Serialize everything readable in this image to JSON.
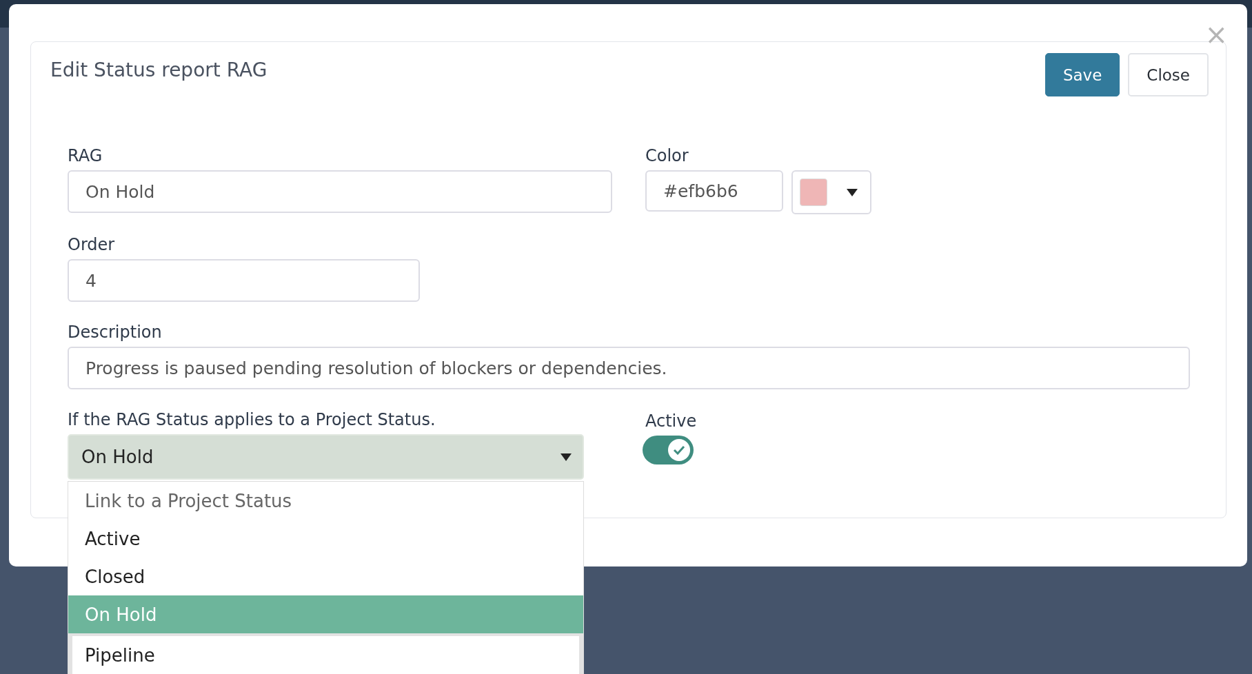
{
  "modal": {
    "title": "Edit Status report RAG",
    "buttons": [
      {
        "label": "Save",
        "kind": "primary"
      },
      {
        "label": "Close",
        "kind": "secondary"
      }
    ],
    "close_icon": "×"
  },
  "form": {
    "rag": {
      "label": "RAG",
      "value": "On Hold"
    },
    "color": {
      "label": "Color",
      "value": "#efb6b6"
    },
    "order": {
      "label": "Order",
      "value": "4"
    },
    "description": {
      "label": "Description",
      "value": "Progress is paused pending resolution of blockers or dependencies."
    },
    "project_status": {
      "label": "If the RAG Status applies to a Project Status.",
      "value": "On Hold",
      "expanded": true,
      "options": [
        {
          "label": "Link to a Project Status",
          "kind": "placeholder",
          "selected": false
        },
        {
          "label": "Active",
          "kind": "option",
          "selected": false
        },
        {
          "label": "Closed",
          "kind": "option",
          "selected": false
        },
        {
          "label": "On Hold",
          "kind": "option",
          "selected": true
        },
        {
          "label": "Pipeline",
          "kind": "option",
          "selected": false
        }
      ]
    },
    "active": {
      "label": "Active",
      "on": true
    }
  }
}
